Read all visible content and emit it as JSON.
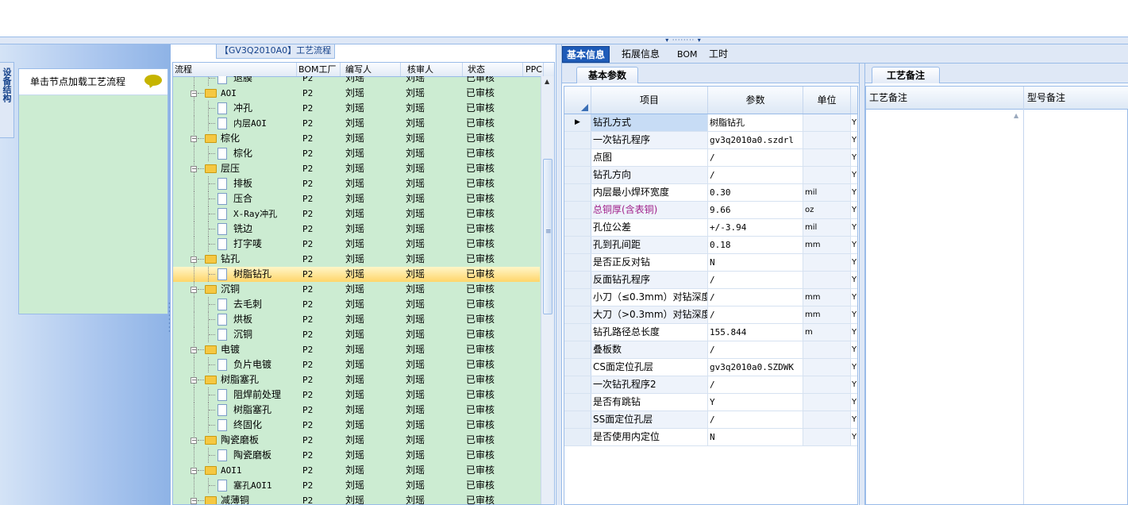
{
  "app": {
    "tree_title": "【GV3Q2010A0】工艺流程",
    "left_vertical_tab": "设备结构",
    "left_hint": "单击节点加载工艺流程"
  },
  "tree": {
    "columns": [
      "流程",
      "BOM工厂",
      "编写人",
      "核审人",
      "状态",
      "PPC"
    ],
    "rows": [
      {
        "level": 2,
        "type": "file",
        "name": "退膜",
        "bom": "P2",
        "writer": "刘瑶",
        "reviewer": "刘瑶",
        "status": "已审核",
        "selected": false
      },
      {
        "level": 1,
        "type": "folder",
        "name": "AOI",
        "bom": "P2",
        "writer": "刘瑶",
        "reviewer": "刘瑶",
        "status": "已审核",
        "selected": false
      },
      {
        "level": 2,
        "type": "file",
        "name": "冲孔",
        "bom": "P2",
        "writer": "刘瑶",
        "reviewer": "刘瑶",
        "status": "已审核",
        "selected": false
      },
      {
        "level": 2,
        "type": "file",
        "name": "内层AOI",
        "bom": "P2",
        "writer": "刘瑶",
        "reviewer": "刘瑶",
        "status": "已审核",
        "selected": false
      },
      {
        "level": 1,
        "type": "folder",
        "name": "棕化",
        "bom": "P2",
        "writer": "刘瑶",
        "reviewer": "刘瑶",
        "status": "已审核",
        "selected": false
      },
      {
        "level": 2,
        "type": "file",
        "name": "棕化",
        "bom": "P2",
        "writer": "刘瑶",
        "reviewer": "刘瑶",
        "status": "已审核",
        "selected": false
      },
      {
        "level": 1,
        "type": "folder",
        "name": "层压",
        "bom": "P2",
        "writer": "刘瑶",
        "reviewer": "刘瑶",
        "status": "已审核",
        "selected": false
      },
      {
        "level": 2,
        "type": "file",
        "name": "排板",
        "bom": "P2",
        "writer": "刘瑶",
        "reviewer": "刘瑶",
        "status": "已审核",
        "selected": false
      },
      {
        "level": 2,
        "type": "file",
        "name": "压合",
        "bom": "P2",
        "writer": "刘瑶",
        "reviewer": "刘瑶",
        "status": "已审核",
        "selected": false
      },
      {
        "level": 2,
        "type": "file",
        "name": "X-Ray冲孔",
        "bom": "P2",
        "writer": "刘瑶",
        "reviewer": "刘瑶",
        "status": "已审核",
        "selected": false
      },
      {
        "level": 2,
        "type": "file",
        "name": "铣边",
        "bom": "P2",
        "writer": "刘瑶",
        "reviewer": "刘瑶",
        "status": "已审核",
        "selected": false
      },
      {
        "level": 2,
        "type": "file",
        "name": "打字唛",
        "bom": "P2",
        "writer": "刘瑶",
        "reviewer": "刘瑶",
        "status": "已审核",
        "selected": false
      },
      {
        "level": 1,
        "type": "folder",
        "name": "钻孔",
        "bom": "P2",
        "writer": "刘瑶",
        "reviewer": "刘瑶",
        "status": "已审核",
        "selected": false
      },
      {
        "level": 2,
        "type": "file",
        "name": "树脂钻孔",
        "bom": "P2",
        "writer": "刘瑶",
        "reviewer": "刘瑶",
        "status": "已审核",
        "selected": true
      },
      {
        "level": 1,
        "type": "folder",
        "name": "沉铜",
        "bom": "P2",
        "writer": "刘瑶",
        "reviewer": "刘瑶",
        "status": "已审核",
        "selected": false
      },
      {
        "level": 2,
        "type": "file",
        "name": "去毛刺",
        "bom": "P2",
        "writer": "刘瑶",
        "reviewer": "刘瑶",
        "status": "已审核",
        "selected": false
      },
      {
        "level": 2,
        "type": "file",
        "name": "烘板",
        "bom": "P2",
        "writer": "刘瑶",
        "reviewer": "刘瑶",
        "status": "已审核",
        "selected": false
      },
      {
        "level": 2,
        "type": "file",
        "name": "沉铜",
        "bom": "P2",
        "writer": "刘瑶",
        "reviewer": "刘瑶",
        "status": "已审核",
        "selected": false
      },
      {
        "level": 1,
        "type": "folder",
        "name": "电镀",
        "bom": "P2",
        "writer": "刘瑶",
        "reviewer": "刘瑶",
        "status": "已审核",
        "selected": false
      },
      {
        "level": 2,
        "type": "file",
        "name": "负片电镀",
        "bom": "P2",
        "writer": "刘瑶",
        "reviewer": "刘瑶",
        "status": "已审核",
        "selected": false
      },
      {
        "level": 1,
        "type": "folder",
        "name": "树脂塞孔",
        "bom": "P2",
        "writer": "刘瑶",
        "reviewer": "刘瑶",
        "status": "已审核",
        "selected": false
      },
      {
        "level": 2,
        "type": "file",
        "name": "阻焊前处理",
        "bom": "P2",
        "writer": "刘瑶",
        "reviewer": "刘瑶",
        "status": "已审核",
        "selected": false
      },
      {
        "level": 2,
        "type": "file",
        "name": "树脂塞孔",
        "bom": "P2",
        "writer": "刘瑶",
        "reviewer": "刘瑶",
        "status": "已审核",
        "selected": false
      },
      {
        "level": 2,
        "type": "file",
        "name": "终固化",
        "bom": "P2",
        "writer": "刘瑶",
        "reviewer": "刘瑶",
        "status": "已审核",
        "selected": false
      },
      {
        "level": 1,
        "type": "folder",
        "name": "陶瓷磨板",
        "bom": "P2",
        "writer": "刘瑶",
        "reviewer": "刘瑶",
        "status": "已审核",
        "selected": false
      },
      {
        "level": 2,
        "type": "file",
        "name": "陶瓷磨板",
        "bom": "P2",
        "writer": "刘瑶",
        "reviewer": "刘瑶",
        "status": "已审核",
        "selected": false
      },
      {
        "level": 1,
        "type": "folder",
        "name": "AOI1",
        "bom": "P2",
        "writer": "刘瑶",
        "reviewer": "刘瑶",
        "status": "已审核",
        "selected": false
      },
      {
        "level": 2,
        "type": "file",
        "name": "塞孔AOI1",
        "bom": "P2",
        "writer": "刘瑶",
        "reviewer": "刘瑶",
        "status": "已审核",
        "selected": false
      },
      {
        "level": 1,
        "type": "folder",
        "name": "减薄铜",
        "bom": "P2",
        "writer": "刘瑶",
        "reviewer": "刘瑶",
        "status": "已审核",
        "selected": false
      }
    ]
  },
  "tabs": {
    "main": [
      "基本信息",
      "拓展信息",
      "BOM",
      "工时"
    ],
    "active_main": "基本信息",
    "basic_sub": "基本参数",
    "note_sub": "工艺备注"
  },
  "params": {
    "columns": [
      "项目",
      "参数",
      "单位"
    ],
    "rows": [
      {
        "item": "钻孔方式",
        "param": "树脂钻孔",
        "unit": "",
        "flag": "Y",
        "highlight": false
      },
      {
        "item": "一次钻孔程序",
        "param": "gv3q2010a0.szdrl",
        "unit": "",
        "flag": "Y",
        "highlight": false
      },
      {
        "item": "点图",
        "param": "/",
        "unit": "",
        "flag": "Y",
        "highlight": false
      },
      {
        "item": "钻孔方向",
        "param": "/",
        "unit": "",
        "flag": "Y",
        "highlight": false
      },
      {
        "item": "内层最小焊环宽度",
        "param": "0.30",
        "unit": "mil",
        "flag": "Y",
        "highlight": false
      },
      {
        "item": "总铜厚(含表铜)",
        "param": "9.66",
        "unit": "oz",
        "flag": "Y",
        "highlight": true
      },
      {
        "item": "孔位公差",
        "param": "+/-3.94",
        "unit": "mil",
        "flag": "Y",
        "highlight": false
      },
      {
        "item": "孔到孔间距",
        "param": "0.18",
        "unit": "mm",
        "flag": "Y",
        "highlight": false
      },
      {
        "item": "是否正反对钻",
        "param": "N",
        "unit": "",
        "flag": "Y",
        "highlight": false
      },
      {
        "item": "反面钻孔程序",
        "param": "/",
        "unit": "",
        "flag": "Y",
        "highlight": false
      },
      {
        "item": "小刀（≤0.3mm）对钻深度",
        "param": "/",
        "unit": "mm",
        "flag": "Y",
        "highlight": false
      },
      {
        "item": "大刀（>0.3mm）对钻深度",
        "param": "/",
        "unit": "mm",
        "flag": "Y",
        "highlight": false
      },
      {
        "item": "钻孔路径总长度",
        "param": "155.844",
        "unit": "m",
        "flag": "Y",
        "highlight": false
      },
      {
        "item": "叠板数",
        "param": "/",
        "unit": "",
        "flag": "Y",
        "highlight": false
      },
      {
        "item": "CS面定位孔层",
        "param": "gv3q2010a0.SZDWK",
        "unit": "",
        "flag": "Y",
        "highlight": false
      },
      {
        "item": "一次钻孔程序2",
        "param": "/",
        "unit": "",
        "flag": "Y",
        "highlight": false
      },
      {
        "item": "是否有跳钻",
        "param": "Y",
        "unit": "",
        "flag": "Y",
        "highlight": false
      },
      {
        "item": "SS面定位孔层",
        "param": "/",
        "unit": "",
        "flag": "Y",
        "highlight": false
      },
      {
        "item": "是否使用内定位",
        "param": "N",
        "unit": "",
        "flag": "Y",
        "highlight": false
      }
    ]
  },
  "notes": {
    "columns": [
      "工艺备注",
      "型号备注"
    ]
  },
  "colors": {
    "tree_bg": "#ccecd2",
    "selected_row": "#ffd56a",
    "active_tab": "#1e5bb8",
    "highlight_text": "#a0208a"
  }
}
